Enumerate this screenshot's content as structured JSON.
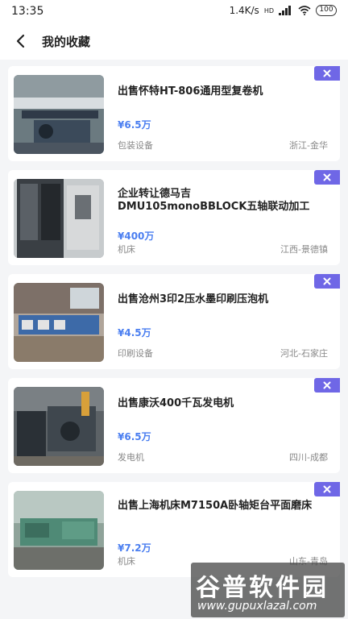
{
  "status_bar": {
    "time": "13:35",
    "speed": "1.4K/s",
    "network": "HD",
    "battery": "100"
  },
  "nav": {
    "title": "我的收藏"
  },
  "items": [
    {
      "title": "出售怀特HT-806通用型复卷机",
      "price": "¥6.5万",
      "category": "包装设备",
      "location": "浙江-金华"
    },
    {
      "title": "企业转让德马吉DMU105monoBBLOCK五轴联动加工",
      "price": "¥400万",
      "category": "机床",
      "location": "江西-景德镇"
    },
    {
      "title": "出售沧州3印2压水墨印刷压泡机",
      "price": "¥4.5万",
      "category": "印刷设备",
      "location": "河北-石家庄"
    },
    {
      "title": "出售康沃400千瓦发电机",
      "price": "¥6.5万",
      "category": "发电机",
      "location": "四川-成都"
    },
    {
      "title": "出售上海机床M7150A卧轴矩台平面磨床",
      "price": "¥7.2万",
      "category": "机床",
      "location": "山东-青岛"
    }
  ],
  "watermark": {
    "brand": "谷普软件园",
    "url": "www.gupuxlazal.com"
  }
}
